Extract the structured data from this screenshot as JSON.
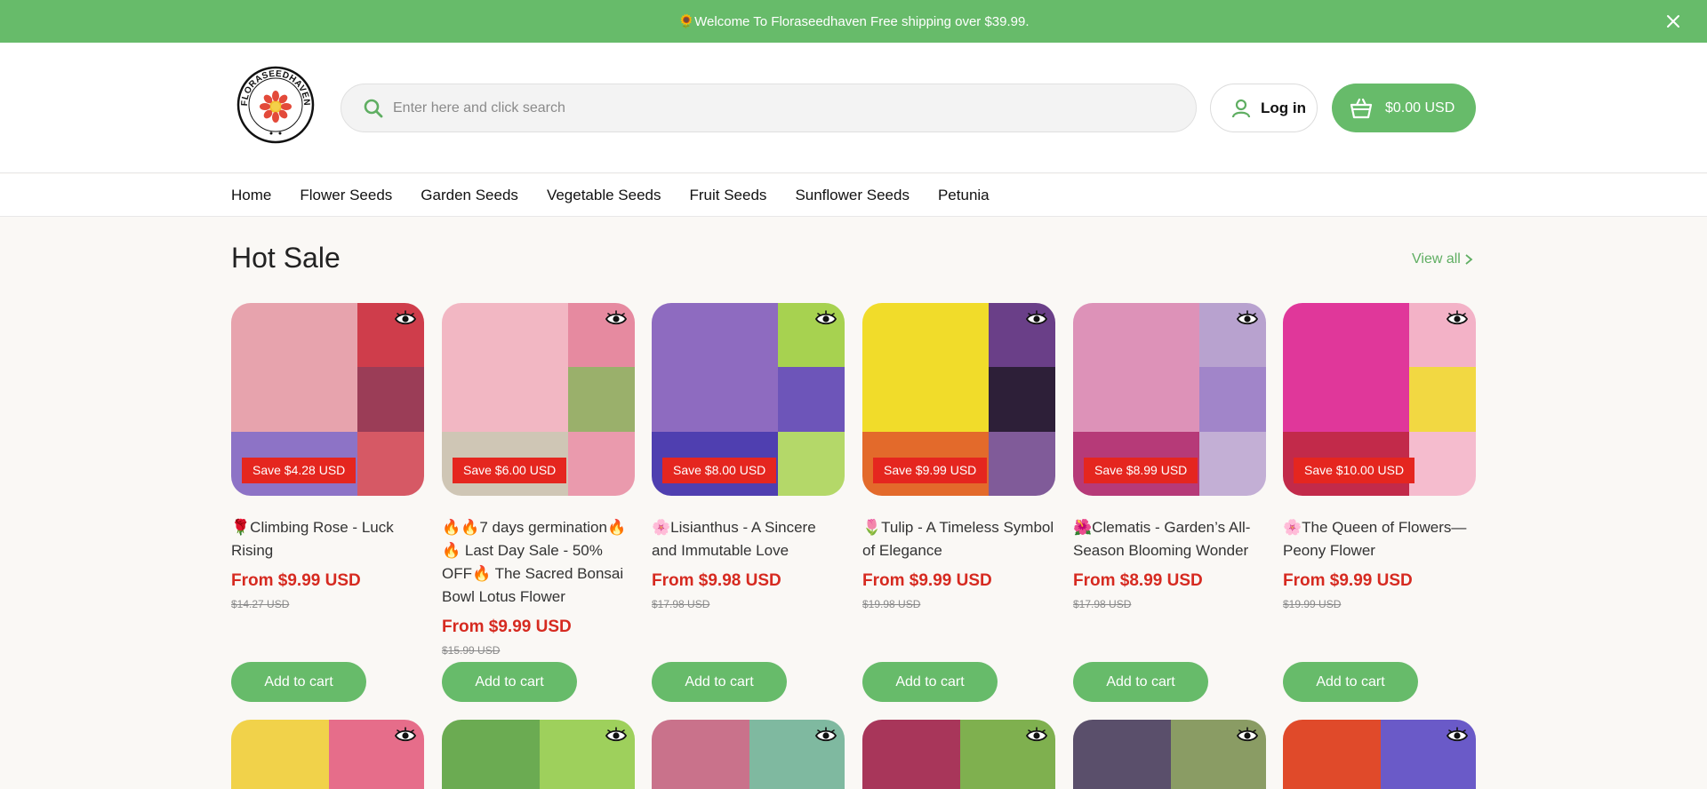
{
  "announcement": {
    "text": "🌻Welcome To Floraseedhaven Free shipping over $39.99."
  },
  "header": {
    "logo_text": "FLORASEEDHAVEN",
    "search_placeholder": "Enter here and click search",
    "login_label": "Log in",
    "cart_label": "$0.00 USD"
  },
  "nav": [
    "Home",
    "Flower Seeds",
    "Garden Seeds",
    "Vegetable Seeds",
    "Fruit Seeds",
    "Sunflower Seeds",
    "Petunia"
  ],
  "section": {
    "title": "Hot Sale",
    "view_all": "View all"
  },
  "products": [
    {
      "title": "🌹Climbing Rose - Luck Rising",
      "price": "From $9.99 USD",
      "compare": "$14.27 USD",
      "badge": "Save $4.28 USD",
      "add_label": "Add to cart",
      "colors": [
        "#e7a3ad",
        "#cf3d4b",
        "#8d73c6",
        "#9b3d57"
      ]
    },
    {
      "title": "🔥🔥7 days germination🔥🔥 Last Day Sale - 50% OFF🔥 The Sacred Bonsai Bowl Lotus Flower",
      "price": "From $9.99 USD",
      "compare": "$15.99 USD",
      "badge": "Save $6.00 USD",
      "add_label": "Add to cart",
      "colors": [
        "#f2b7c3",
        "#e68aa0",
        "#cfc6b5",
        "#9ab06b"
      ]
    },
    {
      "title": "🌸Lisianthus - A Sincere and Immutable Love",
      "price": "From $9.98 USD",
      "compare": "$17.98 USD",
      "badge": "Save $8.00 USD",
      "add_label": "Add to cart",
      "colors": [
        "#8e6bc0",
        "#a7d250",
        "#4f3fb0",
        "#6d55b9"
      ]
    },
    {
      "title": "🌷Tulip - A Timeless Symbol of Elegance",
      "price": "From $9.99 USD",
      "compare": "$19.98 USD",
      "badge": "Save $9.99 USD",
      "add_label": "Add to cart",
      "colors": [
        "#f1dc2a",
        "#6a3f88",
        "#e36a2b",
        "#2d1f38"
      ]
    },
    {
      "title": "🌺Clematis - Garden’s All-Season Blooming Wonder",
      "price": "From $8.99 USD",
      "compare": "$17.98 USD",
      "badge": "Save $8.99 USD",
      "add_label": "Add to cart",
      "colors": [
        "#dd92b8",
        "#b8a2cf",
        "#b63a78",
        "#a185c9"
      ]
    },
    {
      "title": "🌸The Queen of Flowers—Peony Flower",
      "price": "From $9.99 USD",
      "compare": "$19.99 USD",
      "badge": "Save $10.00 USD",
      "add_label": "Add to cart",
      "colors": [
        "#e0379a",
        "#f3b2c7",
        "#c22a4a",
        "#f2d842"
      ]
    }
  ],
  "row2_colors": [
    [
      "#f1d24a",
      "#e66d8a"
    ],
    [
      "#6bab52",
      "#9ed05c"
    ],
    [
      "#c9728b",
      "#7fb9a0"
    ],
    [
      "#a8365a",
      "#7fb04f"
    ],
    [
      "#5a4f6b",
      "#8a9c64"
    ],
    [
      "#e04a2a",
      "#6a5ac8"
    ]
  ]
}
